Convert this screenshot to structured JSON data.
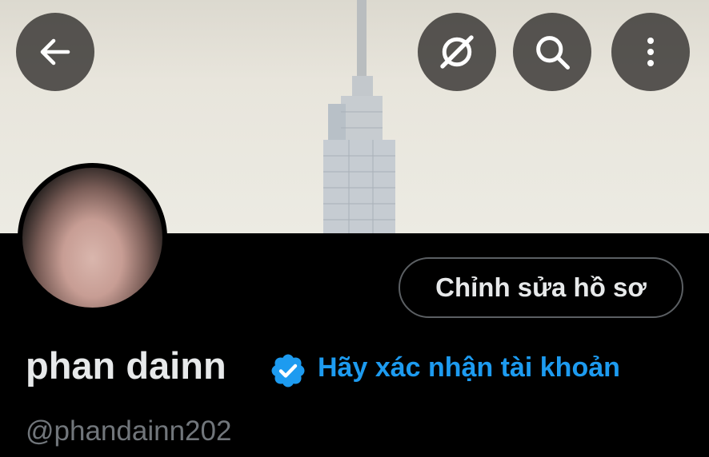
{
  "header": {
    "back_icon": "arrow-left-icon",
    "grok_icon": "grok-icon",
    "search_icon": "search-icon",
    "more_icon": "more-vertical-icon"
  },
  "profile": {
    "display_name": "phan dainn",
    "handle": "@phandainn202",
    "verify_link": "Hãy xác nhận tài khoản",
    "edit_button": "Chỉnh sửa hồ sơ"
  },
  "colors": {
    "accent": "#1d9bf0",
    "background": "#000000",
    "text_primary": "#e7e9ea",
    "text_secondary": "#71767b"
  }
}
